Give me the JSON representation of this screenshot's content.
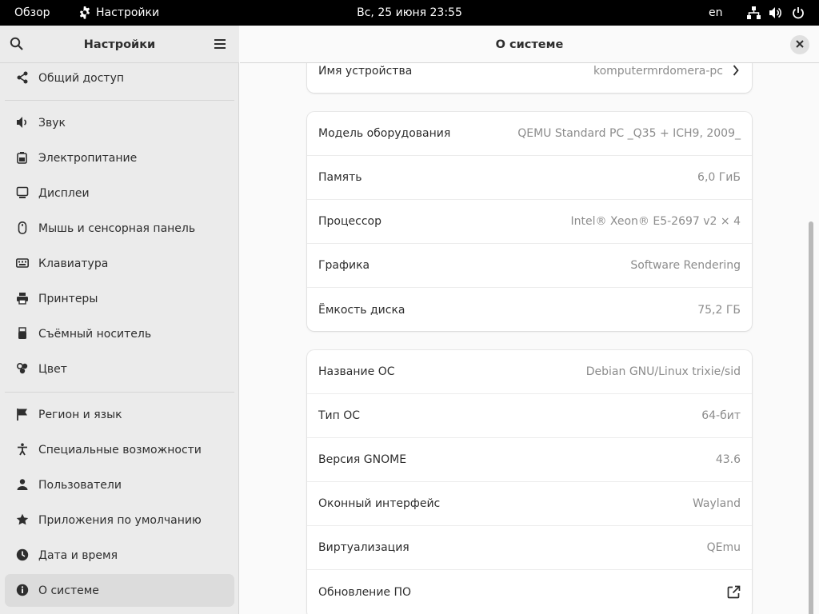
{
  "topbar": {
    "overview": "Обзор",
    "app_name": "Настройки",
    "clock": "Вс, 25 июня  23:55",
    "language": "en"
  },
  "sidebar": {
    "title": "Настройки",
    "items": [
      {
        "label": "Общий доступ",
        "icon": "share-icon"
      },
      {
        "label": "Звук",
        "icon": "speaker-icon"
      },
      {
        "label": "Электропитание",
        "icon": "battery-icon"
      },
      {
        "label": "Дисплеи",
        "icon": "display-icon"
      },
      {
        "label": "Мышь и сенсорная панель",
        "icon": "mouse-icon"
      },
      {
        "label": "Клавиатура",
        "icon": "keyboard-icon"
      },
      {
        "label": "Принтеры",
        "icon": "printer-icon"
      },
      {
        "label": "Съёмный носитель",
        "icon": "usb-icon"
      },
      {
        "label": "Цвет",
        "icon": "color-icon"
      },
      {
        "label": "Регион и язык",
        "icon": "flag-icon"
      },
      {
        "label": "Специальные возможности",
        "icon": "accessibility-icon"
      },
      {
        "label": "Пользователи",
        "icon": "users-icon"
      },
      {
        "label": "Приложения по умолчанию",
        "icon": "star-icon"
      },
      {
        "label": "Дата и время",
        "icon": "clock-icon"
      },
      {
        "label": "О системе",
        "icon": "info-icon",
        "active": true
      }
    ]
  },
  "content": {
    "title": "О системе",
    "device": {
      "key": "Имя устройства",
      "value": "komputermrdomera-pc"
    },
    "hardware": [
      {
        "key": "Модель оборудования",
        "value": "QEMU Standard PC _Q35 + ICH9, 2009_"
      },
      {
        "key": "Память",
        "value": "6,0 ГиБ"
      },
      {
        "key": "Процессор",
        "value": "Intel® Xeon® E5-2697 v2 × 4"
      },
      {
        "key": "Графика",
        "value": "Software Rendering"
      },
      {
        "key": "Ёмкость диска",
        "value": "75,2 ГБ"
      }
    ],
    "os": [
      {
        "key": "Название ОС",
        "value": "Debian GNU/Linux trixie/sid"
      },
      {
        "key": "Тип ОС",
        "value": "64-бит"
      },
      {
        "key": "Версия GNOME",
        "value": "43.6"
      },
      {
        "key": "Оконный интерфейс",
        "value": "Wayland"
      },
      {
        "key": "Виртуализация",
        "value": "QEmu"
      },
      {
        "key": "Обновление ПО",
        "value": ""
      }
    ]
  },
  "colors": {
    "accent": "#3584e4",
    "sidebar_bg": "#ebebeb",
    "content_bg": "#fafafa",
    "topbar_bg": "#000000"
  }
}
